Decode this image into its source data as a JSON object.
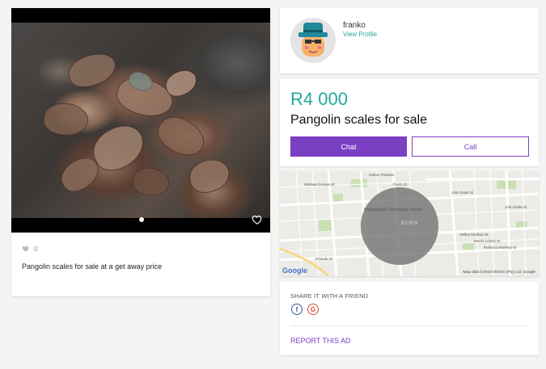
{
  "listing": {
    "likes_count": "0",
    "description": "Pangolin scales for sale at a get away price",
    "photo_alt": "Pangolin scales photo"
  },
  "seller": {
    "name": "franko",
    "view_profile_label": "View Profile"
  },
  "ad": {
    "price": "R4 000",
    "title": "Pangolin scales for sale",
    "chat_label": "Chat",
    "call_label": "Call"
  },
  "map": {
    "area_label": "BUNN",
    "school_label": "Nooitgedacht Secondary School",
    "streets": [
      "Harton Peasant",
      "Mothwa Gosiwa St",
      "Ponzi Dr",
      "John Daka St",
      "John Daka St",
      "Saftee Mothwa St",
      "Morris Lovely St",
      "Rebecca Mothwa St",
      "Khaedu St"
    ],
    "google_logo": "Google",
    "attribution": "Map data ©2018 AfriGIS (Pty) Ltd, Google"
  },
  "share": {
    "heading": "SHARE IT WITH A FRIEND",
    "facebook_glyph": "f",
    "google_glyph": "G",
    "report_label": "REPORT THIS AD"
  },
  "colors": {
    "accent_teal": "#26a69a",
    "brand_purple": "#7b3fc4",
    "page_bg": "#f4f4f4"
  },
  "icons": {
    "favorite": "heart-outline-icon",
    "likes": "heart-icon",
    "facebook": "facebook-icon",
    "google": "google-plus-icon"
  }
}
